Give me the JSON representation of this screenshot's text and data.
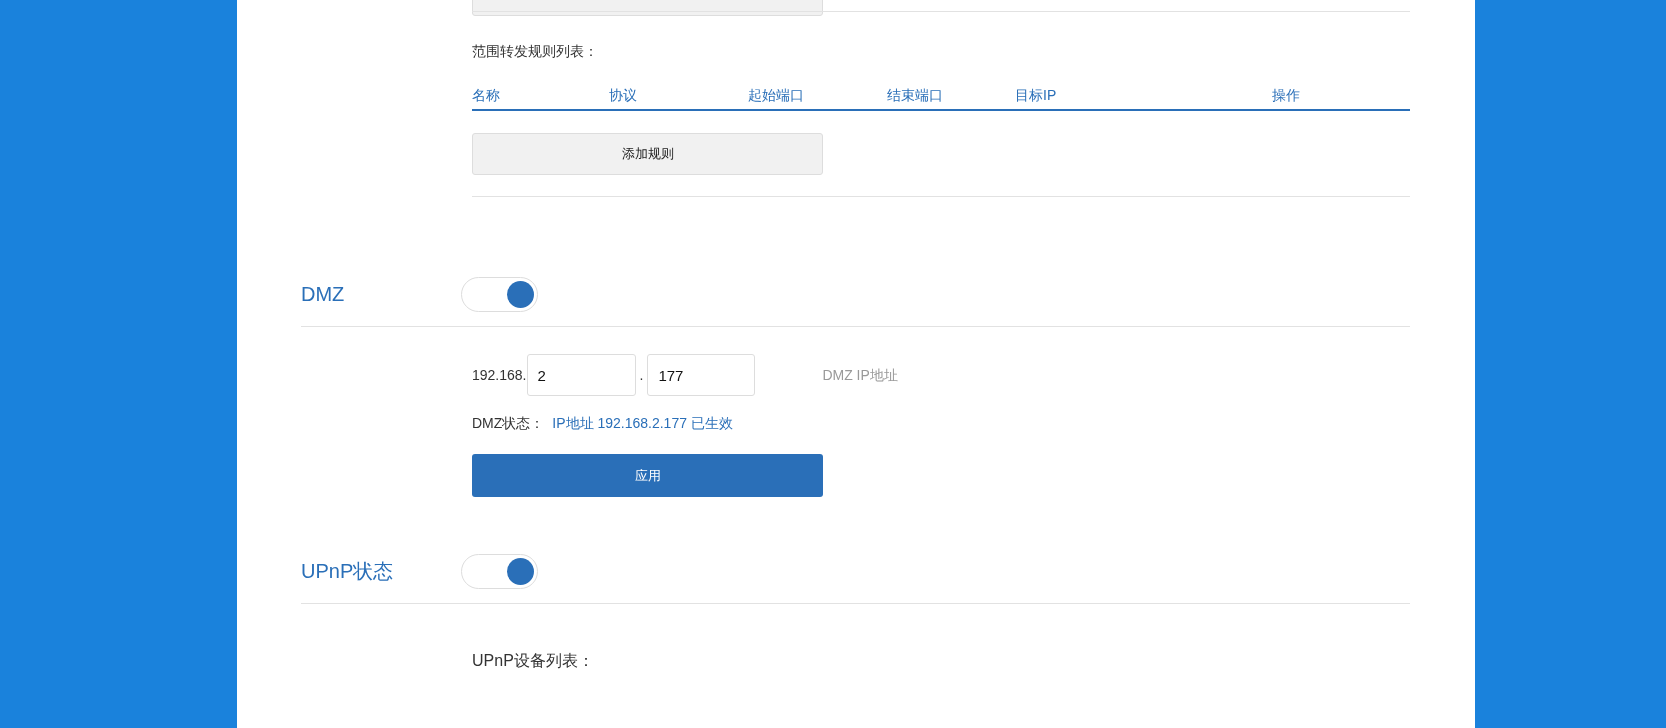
{
  "range_forward": {
    "title": "范围转发规则列表：",
    "columns": [
      "名称",
      "协议",
      "起始端口",
      "结束端口",
      "目标IP",
      "操作"
    ],
    "add_button": "添加规则"
  },
  "dmz": {
    "label": "DMZ",
    "on": true,
    "ip_prefix": "192.168.",
    "octet_3": "2",
    "separator": ".",
    "octet_4": "177",
    "hint": "DMZ IP地址",
    "status_label": "DMZ状态：",
    "status_value": "IP地址 192.168.2.177 已生效",
    "apply_button": "应用"
  },
  "upnp": {
    "label": "UPnP状态",
    "on": true,
    "list_title": "UPnP设备列表："
  }
}
